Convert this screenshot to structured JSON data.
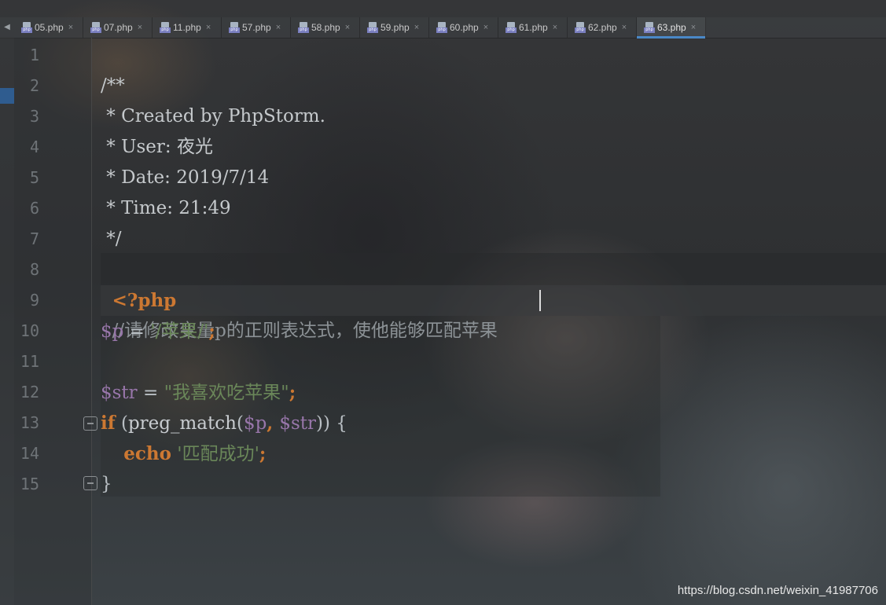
{
  "tabs": [
    {
      "label": "05.php",
      "active": false
    },
    {
      "label": "07.php",
      "active": false
    },
    {
      "label": "11.php",
      "active": false
    },
    {
      "label": "57.php",
      "active": false
    },
    {
      "label": "58.php",
      "active": false
    },
    {
      "label": "59.php",
      "active": false
    },
    {
      "label": "60.php",
      "active": false
    },
    {
      "label": "61.php",
      "active": false
    },
    {
      "label": "62.php",
      "active": false
    },
    {
      "label": "63.php",
      "active": true
    }
  ],
  "tab_icon_badge": "php",
  "tab_close_glyph": "×",
  "tab_scroll_glyph": "◀",
  "line_numbers": [
    "1",
    "2",
    "3",
    "4",
    "5",
    "6",
    "7",
    "8",
    "9",
    "10",
    "11",
    "12",
    "13",
    "14",
    "15"
  ],
  "code": {
    "l2": "/**",
    "l3": " * Created by PhpStorm.",
    "l4": " * User: 夜光",
    "l5": " * Date: 2019/7/14",
    "l6": " * Time: 21:49",
    "l7": " */",
    "l8_tag": "<?php",
    "l9_comment": "//请修改变量p的正则表达式，使他能够匹配苹果",
    "l10_var": "$p",
    "l10_eq": " = ",
    "l10_str": "'/苹果/'",
    "l10_end": ";",
    "l12_var": "$str",
    "l12_eq": " = ",
    "l12_str": "\"我喜欢吃苹果\"",
    "l12_end": ";",
    "l13_kw": "if",
    "l13_a": " (",
    "l13_fn": "preg_match",
    "l13_b": "(",
    "l13_v1": "$p",
    "l13_c": ", ",
    "l13_v2": "$str",
    "l13_d": ")) {",
    "l14_indent": "    ",
    "l14_kw": "echo",
    "l14_sp": " ",
    "l14_str": "'匹配成功'",
    "l14_end": ";",
    "l15": "}"
  },
  "watermark": "https://blog.csdn.net/weixin_41987706",
  "colors": {
    "keyword": "#cc7832",
    "variable": "#9876aa",
    "string": "#6a8759",
    "active_tab_underline": "#4a88c7"
  }
}
